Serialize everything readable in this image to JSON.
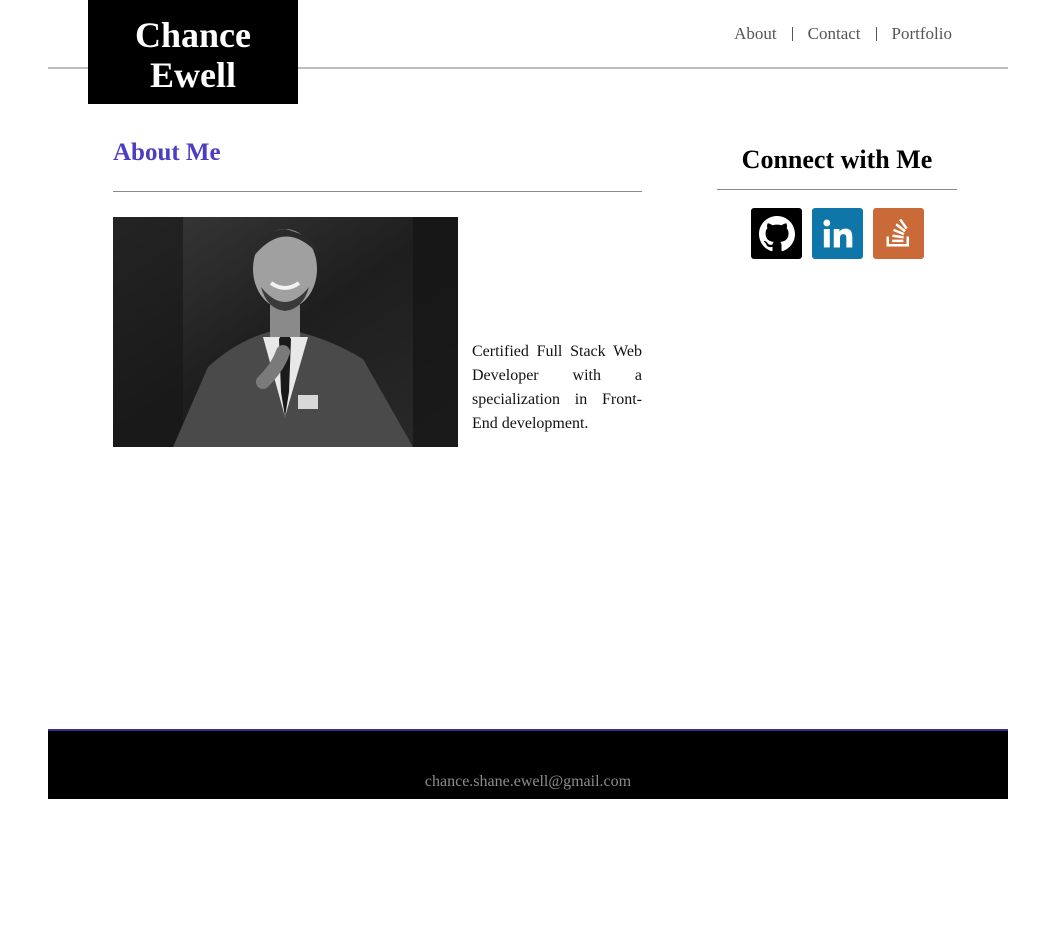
{
  "header": {
    "logo_line1": "Chance",
    "logo_line2": "Ewell",
    "nav": [
      {
        "label": "About"
      },
      {
        "label": "Contact"
      },
      {
        "label": "Portfolio"
      }
    ]
  },
  "about": {
    "title": "About Me",
    "bio": "Certified Full Stack Web Developer with a specialization in Front-End development."
  },
  "connect": {
    "title": "Connect with Me",
    "links": [
      {
        "icon": "github-icon",
        "color": "#000000"
      },
      {
        "icon": "linkedin-icon",
        "color": "#0e76a8"
      },
      {
        "icon": "stackoverflow-icon",
        "color": "#c96a38"
      }
    ]
  },
  "footer": {
    "email": "chance.shane.ewell@gmail.com"
  },
  "colors": {
    "accent": "#4b3ec2",
    "footer_border": "#3a2e8f"
  }
}
